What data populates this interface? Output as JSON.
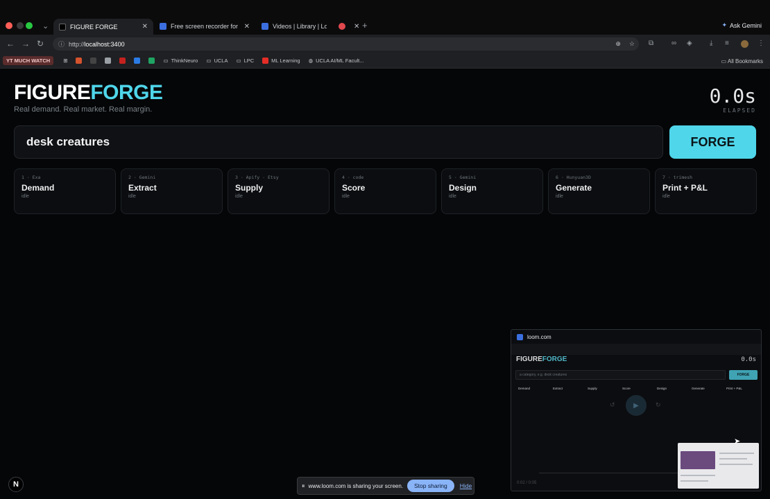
{
  "browser": {
    "tabs": [
      {
        "label": "FIGURE FORGE",
        "active": true
      },
      {
        "label": "Free screen recorder for Mac",
        "active": false
      },
      {
        "label": "Videos | Library | Loom",
        "active": false
      },
      {
        "label": "",
        "active": false
      }
    ],
    "gemini_label": "Ask Gemini",
    "url_prefix": "http://",
    "url_host": "localhost:3400",
    "bookmarks": [
      {
        "label": "YT MUCH WATCH"
      },
      {
        "label": "ThinkNeuro"
      },
      {
        "label": "UCLA"
      },
      {
        "label": "LPC"
      },
      {
        "label": "ML Learning"
      },
      {
        "label": "UCLA AI/ML Facult..."
      }
    ],
    "all_bookmarks": "All Bookmarks"
  },
  "app": {
    "logo_part1": "FIGURE",
    "logo_part2": "FORGE",
    "tagline": "Real demand. Real market. Real margin.",
    "elapsed_value": "0.0s",
    "elapsed_label": "ELAPSED",
    "search_value": "desk creatures",
    "forge_label": "FORGE",
    "steps": [
      {
        "meta": "1 · Exa",
        "name": "Demand",
        "status": "idle"
      },
      {
        "meta": "2 · Gemini",
        "name": "Extract",
        "status": "idle"
      },
      {
        "meta": "3 · Apify · Etsy",
        "name": "Supply",
        "status": "idle"
      },
      {
        "meta": "4 · code",
        "name": "Score",
        "status": "idle"
      },
      {
        "meta": "5 · Gemini",
        "name": "Design",
        "status": "idle"
      },
      {
        "meta": "6 · Hunyuan3D",
        "name": "Generate",
        "status": "idle"
      },
      {
        "meta": "7 · trimesh",
        "name": "Print + P&L",
        "status": "idle"
      }
    ],
    "next_logo": "N"
  },
  "loom_preview": {
    "title": "loom.com",
    "logo_part1": "FIGURE",
    "logo_part2": "FORGE",
    "timer": "0.0s",
    "search_placeholder": "a category, e.g. desk creatures",
    "forge_label": "FORGE",
    "steps": [
      "Demand",
      "Extract",
      "Supply",
      "Score",
      "Design",
      "Generate",
      "Print + P&L"
    ],
    "time": "0:02 / 0:05"
  },
  "share_bar": {
    "message": "www.loom.com is sharing your screen.",
    "stop_label": "Stop sharing",
    "hide_label": "Hide"
  },
  "colors": {
    "accent": "#4fd6ea",
    "background": "#050608",
    "share_button": "#8ab4f8"
  }
}
